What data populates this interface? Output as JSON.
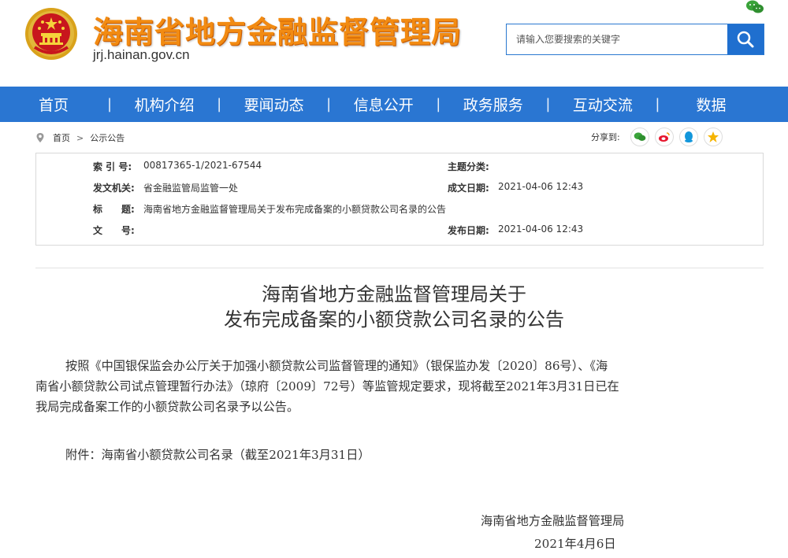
{
  "header": {
    "site_title": "海南省地方金融监督管理局",
    "domain": "jrj.hainan.gov.cn",
    "search_placeholder": "请输入您要搜索的关键字"
  },
  "nav": {
    "items": [
      "首页",
      "机构介绍",
      "要闻动态",
      "信息公开",
      "政务服务",
      "互动交流",
      "数据"
    ]
  },
  "breadcrumb": {
    "home": "首页",
    "separator": ">",
    "current": "公示公告"
  },
  "share": {
    "label": "分享到:",
    "icons": [
      "wechat-icon",
      "weibo-icon",
      "qq-icon",
      "qzone-icon"
    ]
  },
  "meta": {
    "index_label": "索 引 号:",
    "index_value": "00817365-1/2021-67544",
    "topic_label": "主题分类:",
    "topic_value": "",
    "issuer_label": "发文机关:",
    "issuer_value": "省金融监管局监管一处",
    "created_label": "成文日期:",
    "created_value": "2021-04-06 12:43",
    "title_label": "标　　题:",
    "title_value": "海南省地方金融监督管理局关于发布完成备案的小额贷款公司名录的公告",
    "docno_label": "文　　号:",
    "docno_value": "",
    "published_label": "发布日期:",
    "published_value": "2021-04-06 12:43"
  },
  "article": {
    "title_line1": "海南省地方金融监督管理局关于",
    "title_line2": "发布完成备案的小额贷款公司名录的公告",
    "body_line1": "按照《中国银保监会办公厅关于加强小额贷款公司监督管理的通知》（银保监办发〔2020〕86号）、《海",
    "body_line2": "南省小额贷款公司试点管理暂行办法》（琼府〔2009〕72号）等监管规定要求，现将截至2021年3月31日已在",
    "body_line3": "我局完成备案工作的小额贷款公司名录予以公告。",
    "attachment": "附件：海南省小额贷款公司名录（截至2021年3月31日）",
    "signature": "海南省地方金融监督管理局",
    "date": "2021年4月6日"
  },
  "colors": {
    "nav_bg": "#2a76d2",
    "title_orange": "#f28b12",
    "search_btn": "#1f6fcf"
  }
}
